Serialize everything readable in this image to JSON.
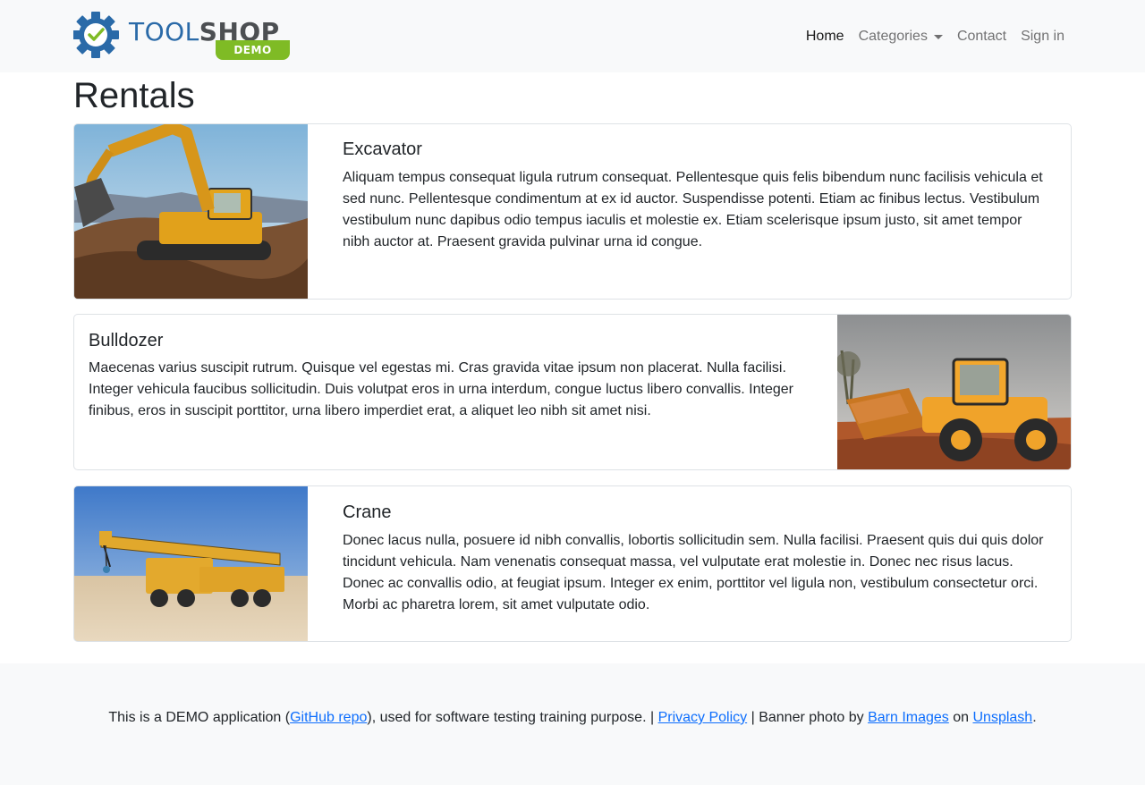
{
  "navbar": {
    "brand": {
      "word_a": "TOOL",
      "word_b": "SHOP",
      "badge": "DEMO",
      "colors": {
        "tool": "#2a6aa8",
        "shop": "#4c4f52",
        "badge": "#7fbb25",
        "check": "#7fbb25"
      }
    },
    "items": [
      {
        "label": "Home",
        "active": true
      },
      {
        "label": "Categories",
        "has_dropdown": true
      },
      {
        "label": "Contact"
      },
      {
        "label": "Sign in"
      }
    ]
  },
  "main": {
    "title": "Rentals",
    "rentals": [
      {
        "title": "Excavator",
        "description": "Aliquam tempus consequat ligula rutrum consequat. Pellentesque quis felis bibendum nunc facilisis vehicula et sed nunc. Pellentesque condimentum at ex id auctor. Suspendisse potenti. Etiam ac finibus lectus. Vestibulum vestibulum nunc dapibus odio tempus iaculis et molestie ex. Etiam scelerisque ipsum justo, sit amet tempor nibh auctor at. Praesent gravida pulvinar urna id congue.",
        "image_side": "left"
      },
      {
        "title": "Bulldozer",
        "description": "Maecenas varius suscipit rutrum. Quisque vel egestas mi. Cras gravida vitae ipsum non placerat. Nulla facilisi. Integer vehicula faucibus sollicitudin. Duis volutpat eros in urna interdum, congue luctus libero convallis. Integer finibus, eros in suscipit porttitor, urna libero imperdiet erat, a aliquet leo nibh sit amet nisi.",
        "image_side": "right"
      },
      {
        "title": "Crane",
        "description": "Donec lacus nulla, posuere id nibh convallis, lobortis sollicitudin sem. Nulla facilisi. Praesent quis dui quis dolor tincidunt vehicula. Nam venenatis consequat massa, vel vulputate erat molestie in. Donec nec risus lacus. Donec ac convallis odio, at feugiat ipsum. Integer ex enim, porttitor vel ligula non, vestibulum consectetur orci. Morbi ac pharetra lorem, sit amet vulputate odio.",
        "image_side": "left"
      }
    ]
  },
  "footer": {
    "text_1": "This is a DEMO application (",
    "link_github": "GitHub repo",
    "text_2": "), used for software testing training purpose. | ",
    "link_privacy": "Privacy Policy",
    "text_3": " | Banner photo by ",
    "link_barn": "Barn Images",
    "text_4": " on ",
    "link_unsplash": "Unsplash",
    "text_5": "."
  }
}
